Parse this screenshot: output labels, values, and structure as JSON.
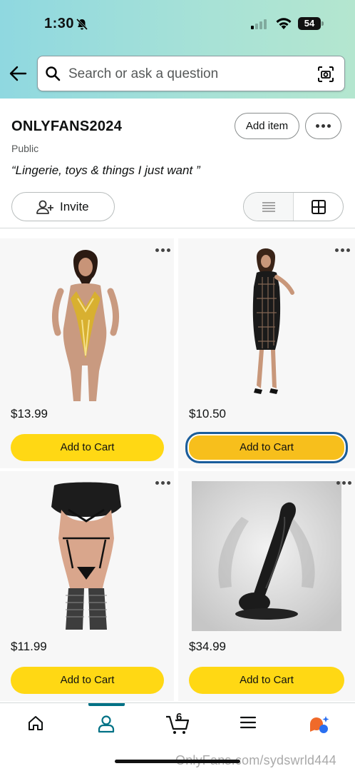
{
  "status_bar": {
    "time": "1:30",
    "battery": "54"
  },
  "search": {
    "placeholder": "Search or ask a question"
  },
  "list": {
    "title": "ONLYFANS2024",
    "visibility": "Public",
    "description": "Lingerie, toys & things I just want",
    "quote_open": "“",
    "quote_close": "”",
    "add_item_label": "Add item",
    "invite_label": "Invite",
    "view_mode": "grid"
  },
  "products": [
    {
      "price": "$13.99",
      "cart_label": "Add to Cart",
      "image": "gold-swimsuit-photo"
    },
    {
      "price": "$10.50",
      "cart_label": "Add to Cart",
      "image": "black-fishnet-dress-photo",
      "focused": true
    },
    {
      "price": "$11.99",
      "cart_label": "Add to Cart",
      "image": "black-lingerie-set-photo"
    },
    {
      "price": "$34.99",
      "cart_label": "Add to Cart",
      "image": "black-toy-photo"
    }
  ],
  "bottom_nav": {
    "items": [
      "home-icon",
      "account-icon",
      "cart-icon",
      "menu-icon",
      "assistant-icon"
    ],
    "active": "account-icon",
    "cart_count": "6"
  },
  "watermark": "OnlyFans.com/sydswrld444",
  "colors": {
    "accent": "#007185",
    "cart_button": "#ffd814",
    "focus_ring": "#1a5d9c"
  }
}
